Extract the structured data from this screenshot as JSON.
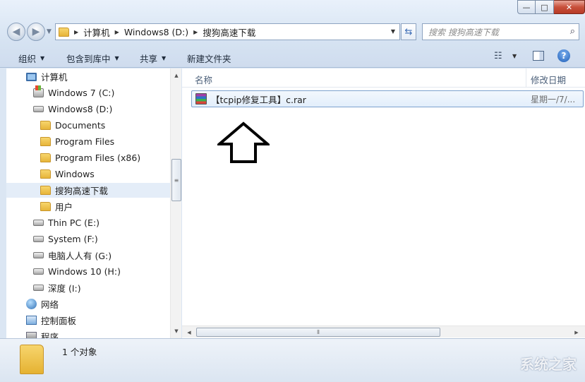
{
  "window": {
    "minimize_label": "—",
    "maximize_label": "□",
    "close_label": "✕"
  },
  "address": {
    "root_label": "计算机",
    "crumbs": [
      "Windows8 (D:)",
      "搜狗高速下载"
    ]
  },
  "search": {
    "placeholder": "搜索 搜狗高速下载"
  },
  "toolbar": {
    "organize_label": "组织",
    "include_label": "包含到库中",
    "share_label": "共享",
    "new_folder_label": "新建文件夹"
  },
  "nav": {
    "items": [
      {
        "label": "计算机",
        "icon": "computer-icon"
      },
      {
        "label": "Windows 7  (C:)",
        "icon": "system-drive-icon"
      },
      {
        "label": "Windows8 (D:)",
        "icon": "drive-icon"
      },
      {
        "label": "Documents",
        "icon": "folder-icon"
      },
      {
        "label": "Program Files",
        "icon": "folder-icon"
      },
      {
        "label": "Program Files (x86)",
        "icon": "folder-icon"
      },
      {
        "label": "Windows",
        "icon": "folder-icon"
      },
      {
        "label": "搜狗高速下载",
        "icon": "folder-icon",
        "selected": true
      },
      {
        "label": "用户",
        "icon": "folder-icon"
      },
      {
        "label": "Thin PC (E:)",
        "icon": "drive-icon"
      },
      {
        "label": "System (F:)",
        "icon": "drive-icon"
      },
      {
        "label": "电脑人人有 (G:)",
        "icon": "drive-icon"
      },
      {
        "label": "Windows 10 (H:)",
        "icon": "drive-icon"
      },
      {
        "label": "深度 (I:)",
        "icon": "drive-icon"
      },
      {
        "label": "网络",
        "icon": "network-icon"
      },
      {
        "label": "控制面板",
        "icon": "control-panel-icon"
      },
      {
        "label": "程序",
        "icon": "programs-icon"
      }
    ]
  },
  "list": {
    "col_name": "名称",
    "col_date": "修改日期",
    "files": [
      {
        "name": "【tcpip修复工具】c.rar",
        "date": "星期一/7/...",
        "icon": "rar-archive-icon"
      }
    ]
  },
  "details": {
    "count": "1 个对象"
  },
  "watermark": "系统之家"
}
